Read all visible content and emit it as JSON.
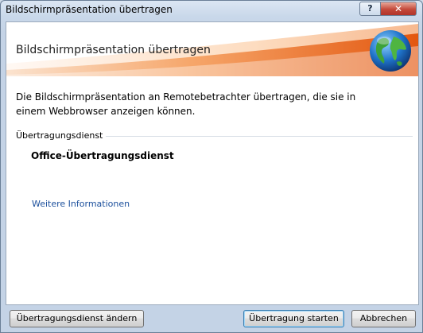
{
  "window": {
    "title": "Bildschirmpräsentation übertragen",
    "help_label": "?",
    "close_label": "✕"
  },
  "banner": {
    "title": "Bildschirmpräsentation übertragen",
    "icon": "globe-icon"
  },
  "description": "Die Bildschirmpräsentation an Remotebetrachter übertragen, die sie in einem Webbrowser anzeigen können.",
  "section": {
    "label": "Übertragungsdienst",
    "service_name": "Office-Übertragungsdienst"
  },
  "more_info_link": "Weitere Informationen",
  "buttons": {
    "change_service": "Übertragungsdienst ändern",
    "start": "Übertragung starten",
    "cancel": "Abbrechen"
  },
  "colors": {
    "accent_orange": "#e8661c",
    "link_blue": "#1b4f9c",
    "window_frame": "#c4d3e6"
  }
}
